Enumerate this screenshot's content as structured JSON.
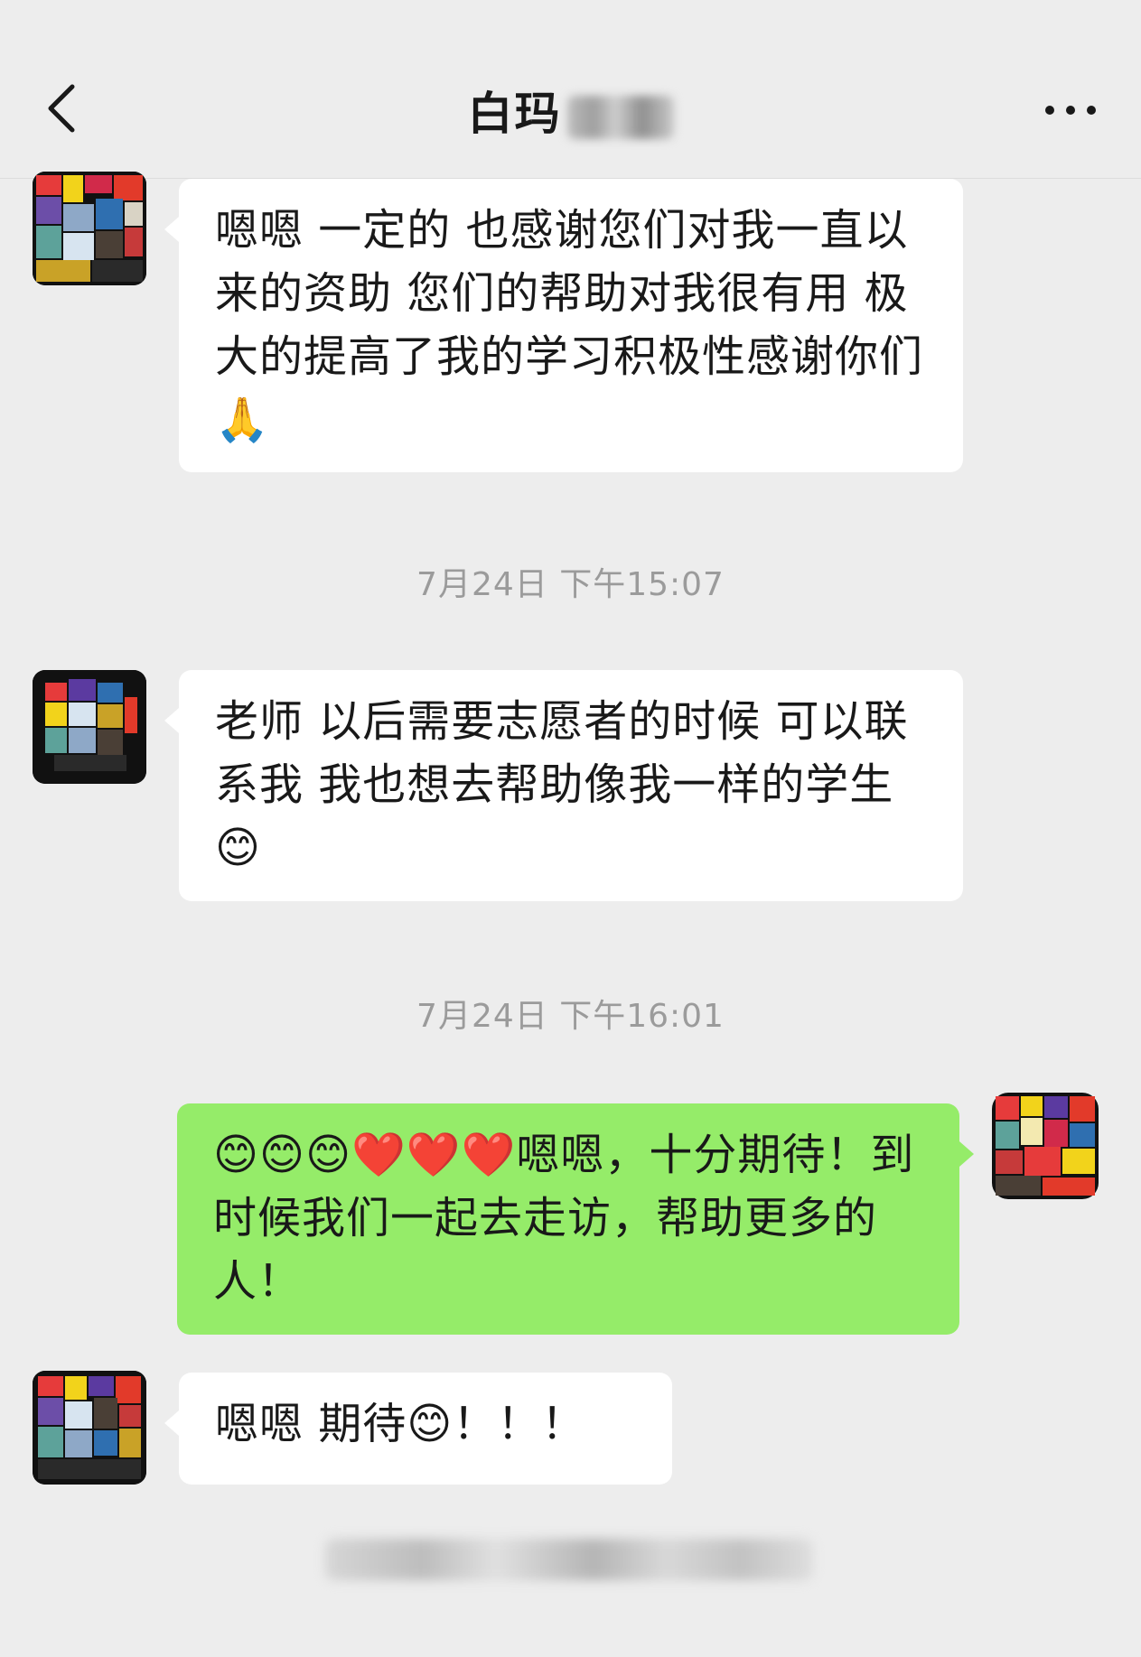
{
  "header": {
    "title": "白玛",
    "back_icon": "chevron-left-icon",
    "more_icon": "ellipsis-icon"
  },
  "messages": [
    {
      "sender": "contact",
      "text": "嗯嗯 一定的 也感谢您们对我一直以来的资助 您们的帮助对我很有用 极大的提高了我的学习积极性感谢你们🙏"
    },
    {
      "timestamp": "7月24日 下午15:07"
    },
    {
      "sender": "contact",
      "text": "老师 以后需要志愿者的时候 可以联系我 我也想去帮助像我一样的学生😊"
    },
    {
      "timestamp": "7月24日 下午16:01"
    },
    {
      "sender": "me",
      "text": "😊😊😊❤️❤️❤️嗯嗯，十分期待！到时候我们一起去走访，帮助更多的人！"
    },
    {
      "sender": "contact",
      "text": "嗯嗯 期待😊！！！"
    }
  ],
  "colors": {
    "background": "#ededed",
    "incoming_bubble": "#ffffff",
    "outgoing_bubble": "#95ec69",
    "timestamp_text": "#9b9b9b"
  }
}
